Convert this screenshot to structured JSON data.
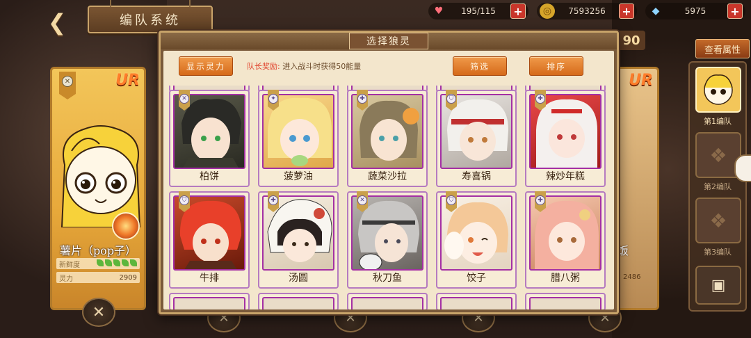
{
  "window": {
    "title": "编队系统",
    "back_icon": "back-arrow-icon"
  },
  "resources": [
    {
      "icon": "heart-icon",
      "value": "195/115"
    },
    {
      "icon": "coin-icon",
      "value": "7593256"
    },
    {
      "icon": "crystal-icon",
      "value": "5975"
    }
  ],
  "lead_card": {
    "rarity": "UR",
    "name": "薯片（pop子）",
    "freshness_label": "新鲜度",
    "freshness_leaves": 5,
    "power_label": "灵力",
    "power_value": "2909"
  },
  "right_card": {
    "rarity": "UR",
    "name_partial": "饭",
    "power_partial": "2486",
    "top_partial": "90"
  },
  "view_attributes_label": "查看属性",
  "teams": [
    {
      "label": "第1编队",
      "active": true
    },
    {
      "label": "第2编队",
      "active": false
    },
    {
      "label": "第3编队",
      "active": false
    }
  ],
  "modal": {
    "title": "选择狼灵",
    "show_power_button": "显示灵力",
    "reward_label": "队长奖励:",
    "reward_text": "进入战斗时获得50能量",
    "filter_button": "筛选",
    "sort_button": "排序",
    "cards_row1": [
      {
        "name": "柏饼",
        "element": "wind"
      },
      {
        "name": "菠萝油",
        "element": "light"
      },
      {
        "name": "蔬菜沙拉",
        "element": "nature"
      },
      {
        "name": "寿喜锅",
        "element": "shield"
      },
      {
        "name": "辣炒年糕",
        "element": "nature"
      }
    ],
    "cards_row2": [
      {
        "name": "牛排",
        "element": "shield"
      },
      {
        "name": "汤圆",
        "element": "nature"
      },
      {
        "name": "秋刀鱼",
        "element": "wind"
      },
      {
        "name": "饺子",
        "element": "shield"
      },
      {
        "name": "腊八粥",
        "element": "nature"
      }
    ]
  },
  "colors": {
    "accent_orange": "#d56a1a",
    "card_border_purple": "#a42fa4",
    "panel_bg": "#f3e6cc",
    "frame_brown": "#7a5a3a",
    "plus_red": "#c9362a"
  }
}
